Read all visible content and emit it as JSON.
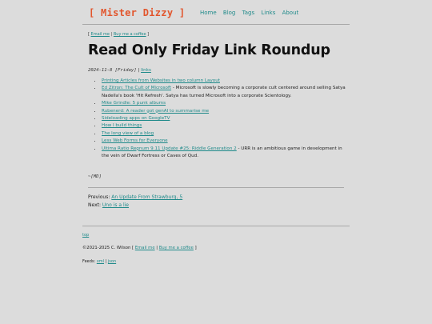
{
  "site": {
    "logo": "[ Mister Dizzy ]",
    "nav": [
      "Home",
      "Blog",
      "Tags",
      "Links",
      "About"
    ]
  },
  "contact": {
    "open": "[ ",
    "email": "Email me",
    "sep": " | ",
    "coffee": "Buy me a coffee",
    "close": " ]"
  },
  "post": {
    "title": "Read Only Friday Link Roundup",
    "date": "2024-11-8 [Friday]",
    "sep": " | ",
    "tag": "links",
    "items": [
      {
        "link": "Printing Articles from Websites in two column Layout",
        "desc": ""
      },
      {
        "link": "Ed Zitron: The Cult of Microsoft",
        "desc": " - Microsoft is slowly becoming a corporate cult centered around selling Satya Nadella's book 'Hit Refresh'. Satya has turned Microsoft into a corporate Scientology."
      },
      {
        "link": "Mike Grindle: 5 punk albums",
        "desc": ""
      },
      {
        "link": "Rubenerd: A reader got genAI to summarise me",
        "desc": ""
      },
      {
        "link": "Sideloading apps on GoogleTV",
        "desc": ""
      },
      {
        "link": "How I build things",
        "desc": ""
      },
      {
        "link": "The long view of a blog",
        "desc": ""
      },
      {
        "link": "Less Web Forms for Everyone",
        "desc": ""
      },
      {
        "link": "Ultima Ratio Regnum 9.11 Update #25: Riddle Generation 2",
        "desc": " - URR is an ambitious game in development in the vein of Dwarf Fortress or Caves of Qud."
      }
    ],
    "signature": "~[MD]"
  },
  "pager": {
    "prev_label": "Previous: ",
    "prev_link": "An Update From Strawburg, 5",
    "next_label": "Next: ",
    "next_link": "Uno is a lie"
  },
  "footer": {
    "top": "top",
    "copyright": "©2021-2025 C. Wilson [ ",
    "email": "Email me",
    "sep": " | ",
    "coffee": "Buy me a coffee",
    "close": " ]",
    "feeds_label": "Feeds: ",
    "feed_xml": "xml",
    "feed_sep": " | ",
    "feed_json": "json"
  }
}
